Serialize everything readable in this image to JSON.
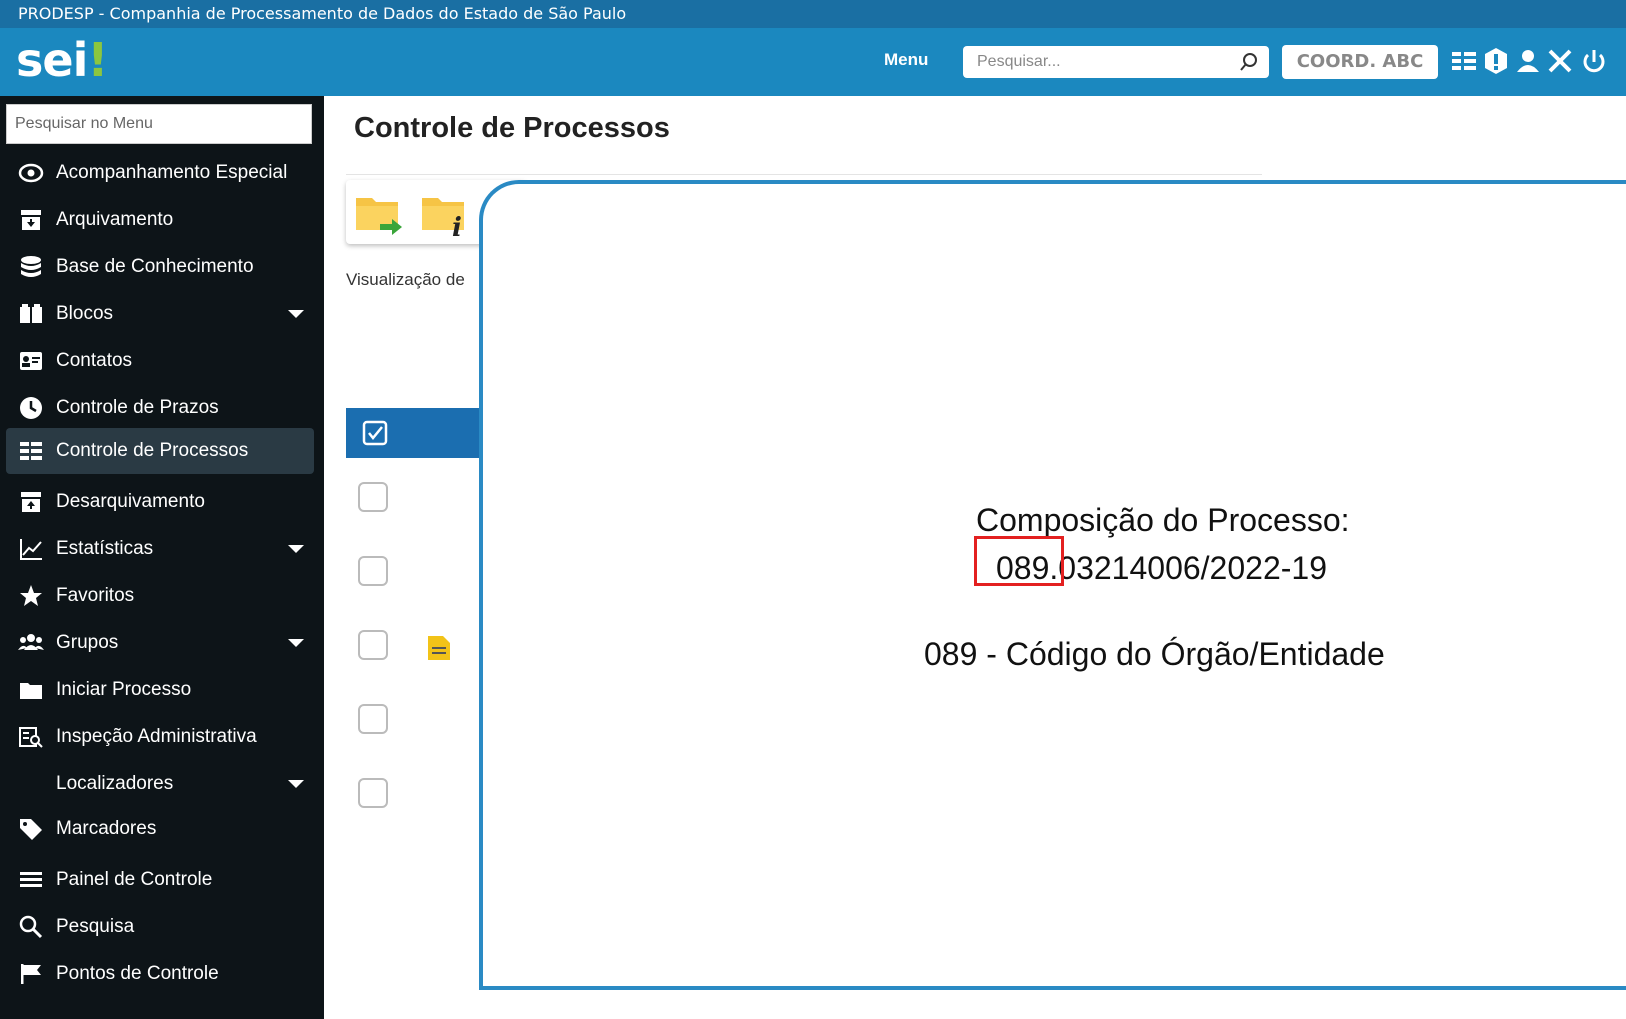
{
  "org_banner": "PRODESP - Companhia de Processamento de Dados do Estado de São Paulo",
  "header": {
    "logo_main": "sei",
    "logo_mark": "!",
    "menu_label": "Menu",
    "search_placeholder": "Pesquisar...",
    "unit_label": "COORD. ABC",
    "icons": [
      "list-icon",
      "alert-icon",
      "user-icon",
      "tools-icon",
      "power-icon"
    ]
  },
  "sidebar": {
    "search_placeholder": "Pesquisar no Menu",
    "items": [
      {
        "label": "Acompanhamento Especial",
        "icon": "eye-icon",
        "has_submenu": false,
        "active": false
      },
      {
        "label": "Arquivamento",
        "icon": "archive-icon",
        "has_submenu": false,
        "active": false
      },
      {
        "label": "Base de Conhecimento",
        "icon": "database-icon",
        "has_submenu": false,
        "active": false
      },
      {
        "label": "Blocos",
        "icon": "blocks-icon",
        "has_submenu": true,
        "active": false
      },
      {
        "label": "Contatos",
        "icon": "contact-card-icon",
        "has_submenu": false,
        "active": false
      },
      {
        "label": "Controle de Prazos",
        "icon": "clock-icon",
        "has_submenu": false,
        "active": false
      },
      {
        "label": "Controle de Processos",
        "icon": "list-icon",
        "has_submenu": false,
        "active": true
      },
      {
        "label": "Desarquivamento",
        "icon": "unarchive-icon",
        "has_submenu": false,
        "active": false
      },
      {
        "label": "Estatísticas",
        "icon": "chart-line-icon",
        "has_submenu": true,
        "active": false
      },
      {
        "label": "Favoritos",
        "icon": "star-icon",
        "has_submenu": false,
        "active": false
      },
      {
        "label": "Grupos",
        "icon": "group-icon",
        "has_submenu": true,
        "active": false
      },
      {
        "label": "Iniciar Processo",
        "icon": "folder-icon",
        "has_submenu": false,
        "active": false
      },
      {
        "label": "Inspeção Administrativa",
        "icon": "inspection-icon",
        "has_submenu": false,
        "active": false
      },
      {
        "label": "Localizadores",
        "icon": "",
        "has_submenu": true,
        "active": false
      },
      {
        "label": "Marcadores",
        "icon": "tag-icon",
        "has_submenu": false,
        "active": false
      },
      {
        "label": "Painel de Controle",
        "icon": "menu-lines-icon",
        "has_submenu": false,
        "active": false
      },
      {
        "label": "Pesquisa",
        "icon": "search-icon",
        "has_submenu": false,
        "active": false
      },
      {
        "label": "Pontos de Controle",
        "icon": "flag-icon",
        "has_submenu": false,
        "active": false
      }
    ]
  },
  "main": {
    "title": "Controle de Processos",
    "toolbar_icons": [
      "send-process-folder-icon",
      "process-info-folder-icon",
      "folder-icon"
    ],
    "view_text": "Visualização de"
  },
  "overlay": {
    "line1": "Composição do Processo:",
    "line2_highlight": "089",
    "line2_rest": ".03214006/2022-19",
    "line3": "089 - Código do Órgão/Entidade"
  },
  "colors": {
    "header_bg": "#1b88bf",
    "banner_bg": "#1a6fa3",
    "sidebar_bg": "#0d1418",
    "table_header_bg": "#1b6eb0",
    "overlay_border": "#2a8ac4",
    "highlight_border": "#e32020",
    "logo_accent": "#8cc63f"
  }
}
